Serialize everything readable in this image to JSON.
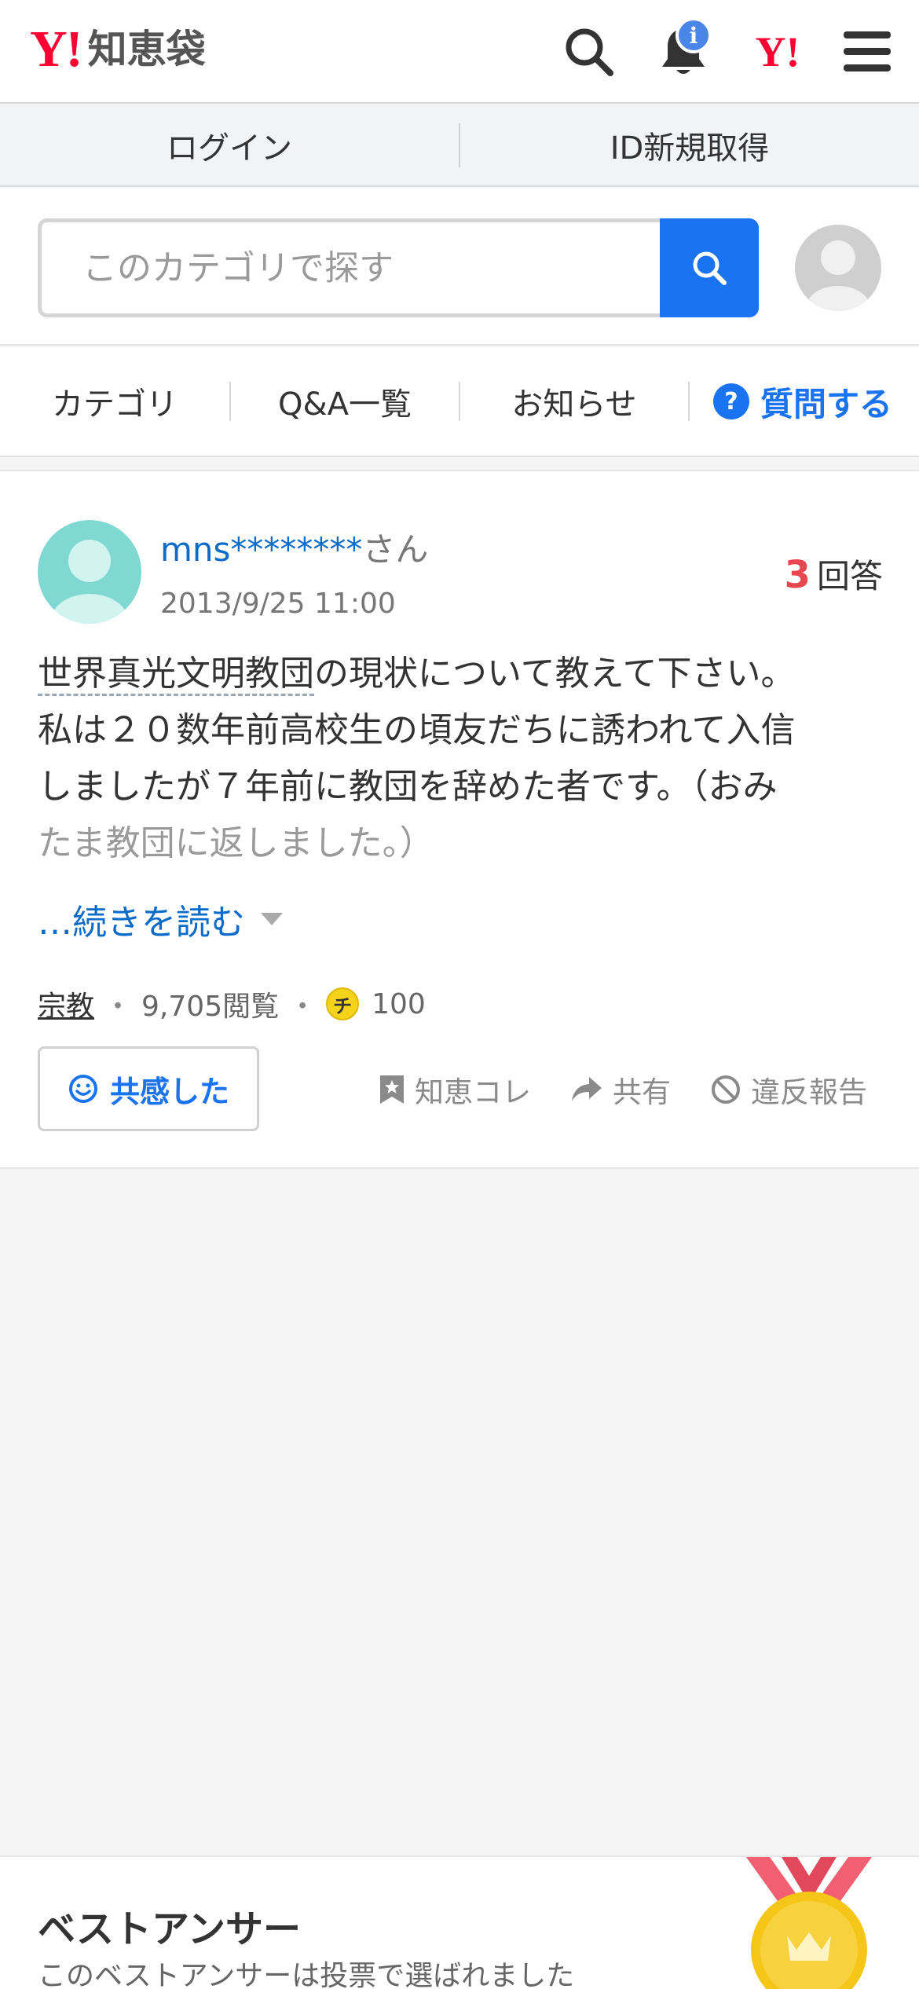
{
  "header": {
    "logo_mark": "Y!",
    "logo_text": "知恵袋",
    "notification_badge": "i",
    "yahoo_mark": "Y!"
  },
  "auth": {
    "login": "ログイン",
    "register": "ID新規取得"
  },
  "search": {
    "placeholder": "このカテゴリで探す"
  },
  "nav": {
    "category": "カテゴリ",
    "qa_list": "Q&A一覧",
    "notices": "お知らせ",
    "ask_icon": "?",
    "ask": "質問する"
  },
  "question": {
    "user_name": "mns********",
    "user_suffix": "さん",
    "date": "2013/9/25 11:00",
    "answer_count": "3",
    "answer_label": "回答",
    "body_keyword": "世界真光文明教団",
    "body_line1_rest": "の現状について教えて下さい。",
    "body_line2": "私は２０数年前高校生の頃友だちに誘われて入信",
    "body_line3": "しましたが７年前に教団を辞めた者です。（おみ",
    "body_line4": "たま教団に返しました。）",
    "read_more": "…続きを読む",
    "category": "宗教",
    "views": "9,705閲覧",
    "coin_symbol": "チ",
    "coins": "100",
    "empathy_button": "共感した",
    "action_collect": "知恵コレ",
    "action_share": "共有",
    "action_report": "違反報告"
  },
  "best_answer": {
    "title": "ベストアンサー",
    "subtitle": "このベストアンサーは投票で選ばれました"
  },
  "colors": {
    "yahoo_red": "#ff0033",
    "link_blue": "#0b6bc8",
    "accent_blue": "#1a73f0",
    "answer_count_red": "#e8474f",
    "medal_gold": "#f5c518"
  }
}
